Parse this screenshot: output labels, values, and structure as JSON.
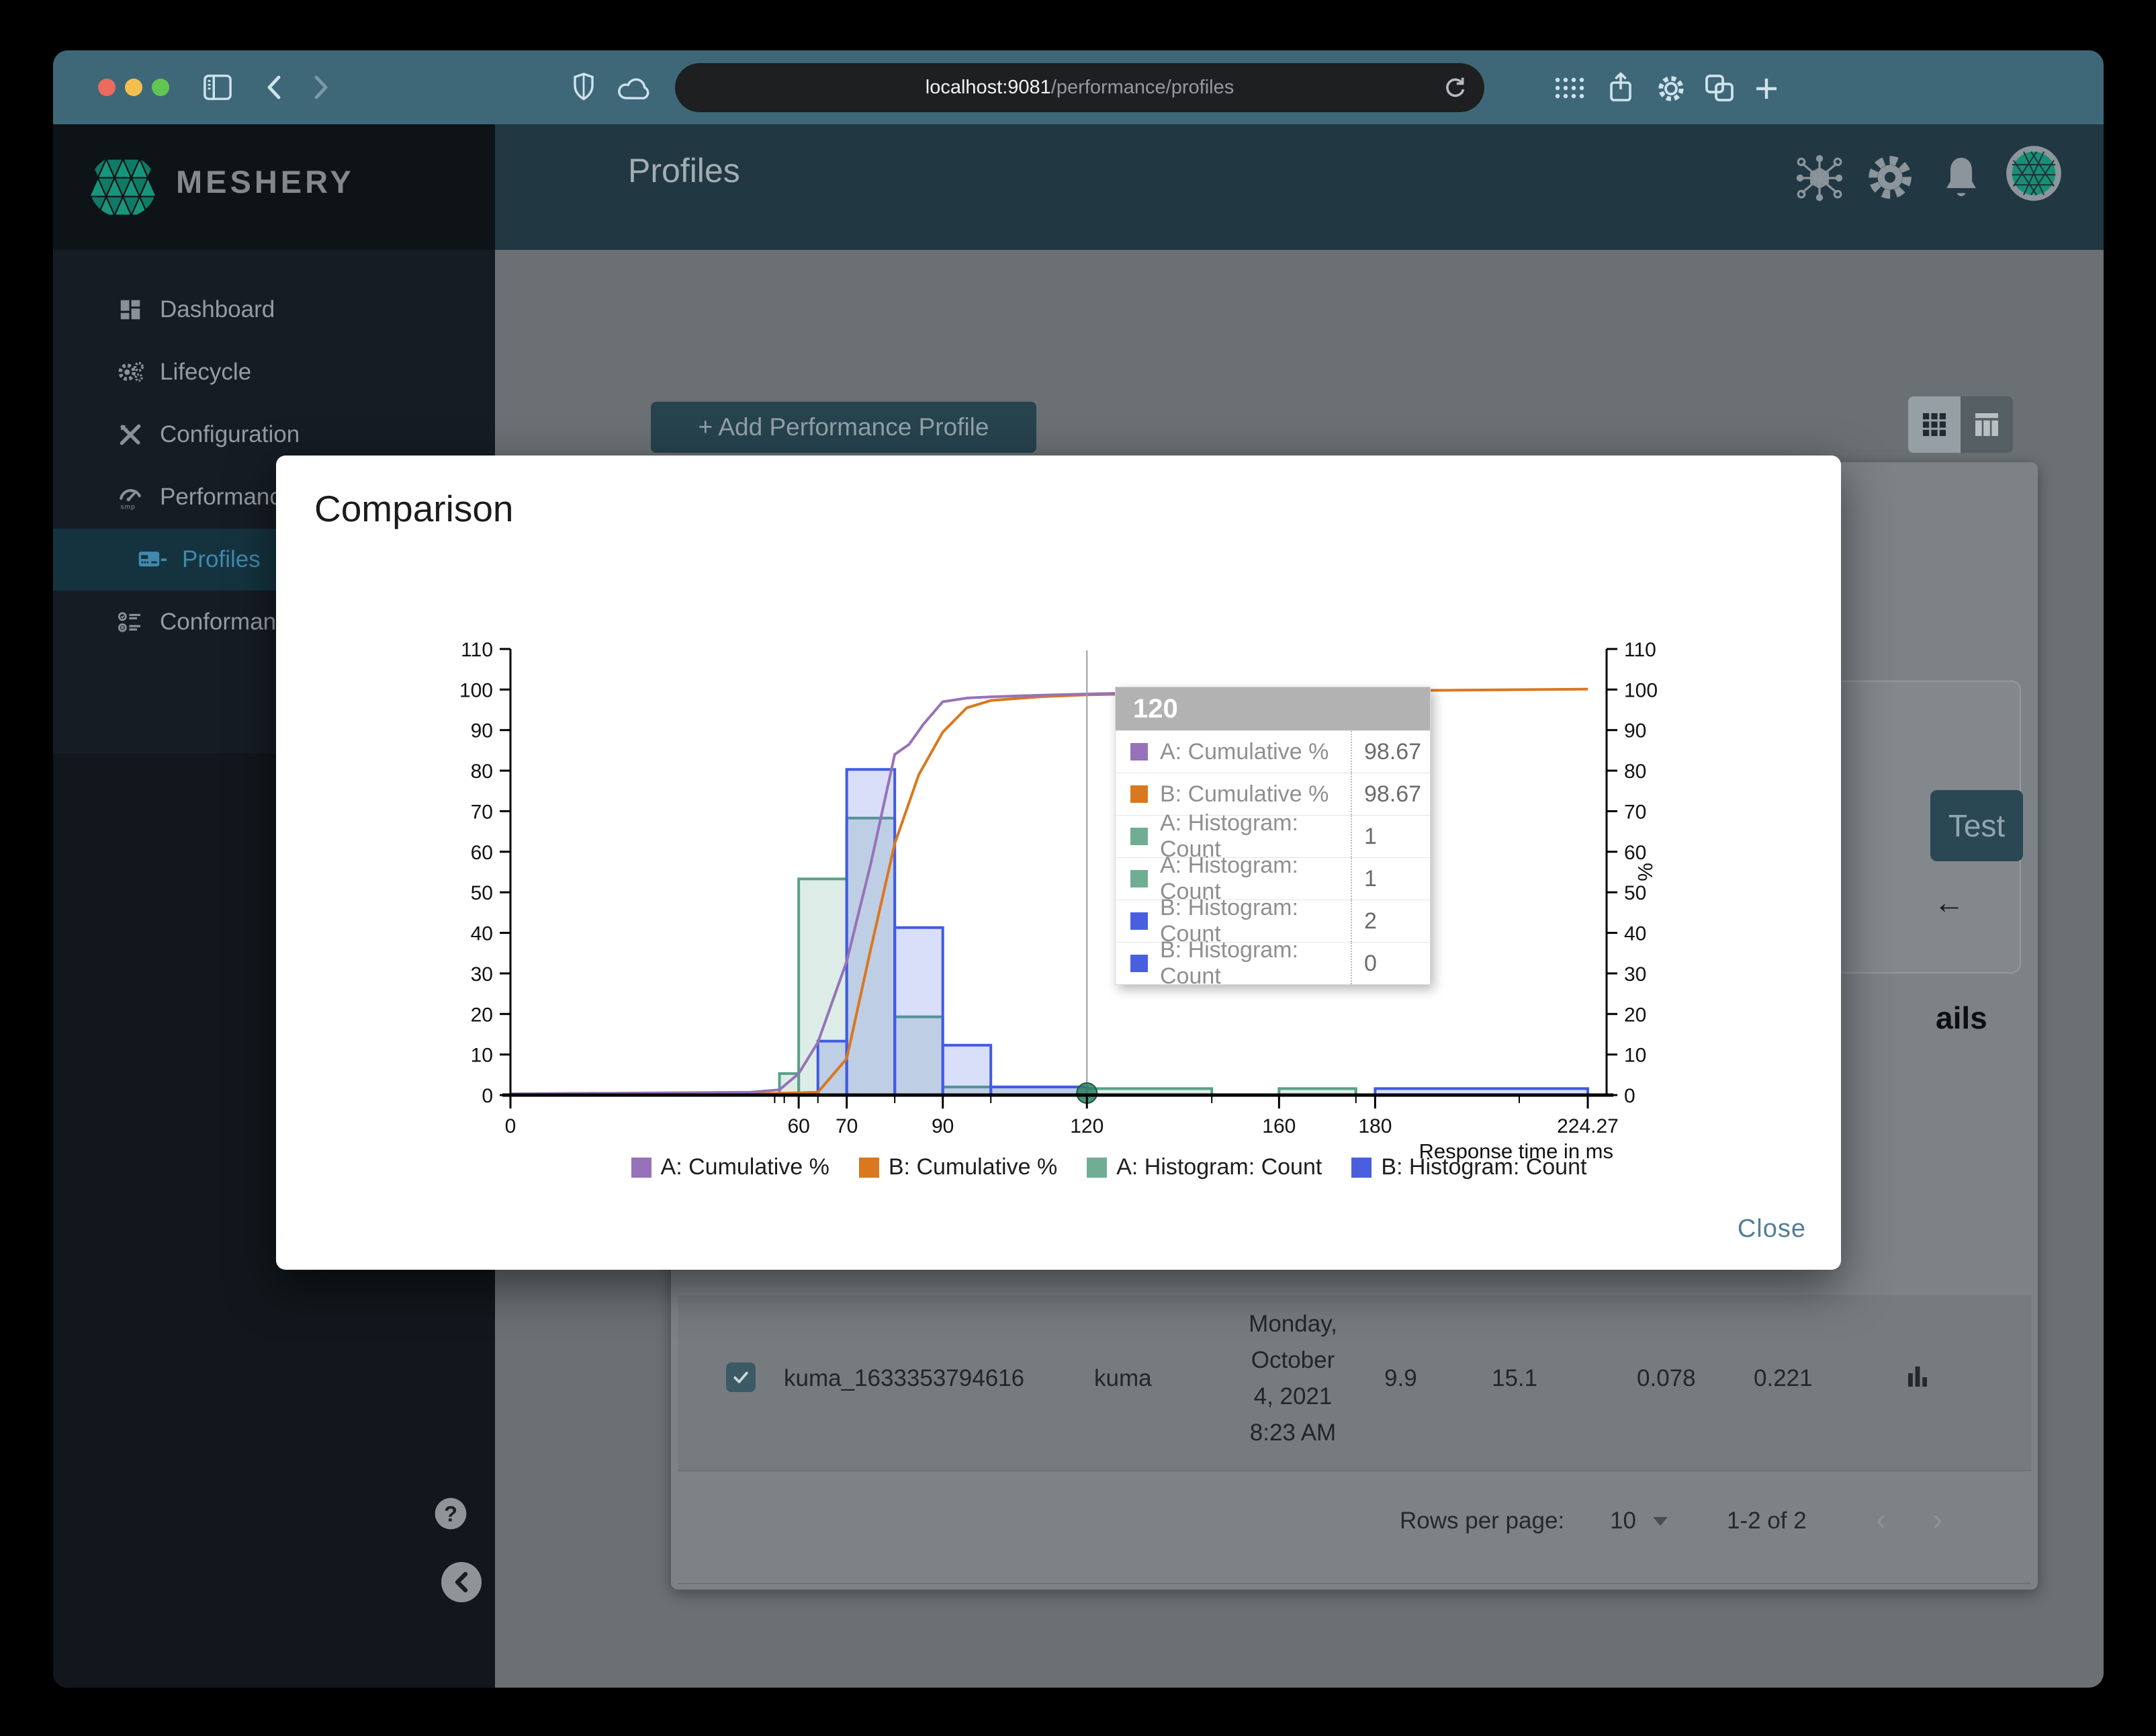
{
  "browser": {
    "url_host": "localhost:9081",
    "url_path": "/performance/profiles",
    "traffic_lights": [
      "#ec6a5e",
      "#f4bf4f",
      "#61c554"
    ]
  },
  "sidebar": {
    "brand": "MESHERY",
    "items": [
      {
        "label": "Dashboard",
        "active": false
      },
      {
        "label": "Lifecycle",
        "active": false
      },
      {
        "label": "Configuration",
        "active": false
      },
      {
        "label": "Performance",
        "active": false
      },
      {
        "label": "Profiles",
        "active": true
      },
      {
        "label": "Conformance",
        "active": false
      }
    ]
  },
  "header": {
    "title": "Profiles"
  },
  "content": {
    "add_profile_button": "+ Add Performance Profile",
    "test_button": "Test",
    "back_arrow": "←",
    "partial_heading": "ails",
    "table_row": {
      "name": "kuma_1633353794616",
      "mesh": "kuma",
      "date_lines": [
        "Monday,",
        "October",
        "4, 2021",
        "8:23 AM"
      ],
      "qps": "9.9",
      "duration": "15.1",
      "p50": "0.078",
      "p99": "0.221"
    },
    "pagination": {
      "rows_per_page_label": "Rows per page:",
      "rows_per_page_value": "10",
      "range": "1-2 of 2",
      "prev_icon": "‹",
      "next_icon": "›"
    }
  },
  "modal": {
    "title": "Comparison",
    "close_label": "Close"
  },
  "ui_colors": {
    "toolbar": "#3e6878",
    "header": "#213842",
    "active_nav": "#4189ad",
    "close_button": "#527e93"
  },
  "chart_data": {
    "type": "histogram+cumulative-line",
    "xlabel": "Response time in ms",
    "right_ylabel": "%",
    "xlim": [
      0,
      224.27
    ],
    "ylim": [
      0,
      110
    ],
    "x_ticks": [
      0,
      60,
      70,
      90,
      120,
      160,
      180,
      224.27
    ],
    "x_minor_ticks": [
      55,
      57,
      64,
      80,
      100,
      146,
      176,
      210
    ],
    "y_ticks": [
      0,
      10,
      20,
      30,
      40,
      50,
      60,
      70,
      80,
      90,
      100,
      110
    ],
    "grid": false,
    "legend_position": "bottom",
    "series": [
      {
        "name": "A: Cumulative %",
        "type": "line",
        "color": "#9673b9",
        "points": [
          [
            0,
            0.3
          ],
          [
            50,
            0.7
          ],
          [
            56,
            1.3
          ],
          [
            60,
            5.3
          ],
          [
            64,
            13
          ],
          [
            70,
            33
          ],
          [
            75,
            57
          ],
          [
            80,
            84
          ],
          [
            83,
            86.5
          ],
          [
            86,
            91.5
          ],
          [
            90,
            97
          ],
          [
            95,
            97.9
          ],
          [
            100,
            98.2
          ],
          [
            110,
            98.6
          ],
          [
            120,
            98.9
          ],
          [
            135,
            99.3
          ],
          [
            150,
            99.8
          ],
          [
            170,
            100.4
          ]
        ]
      },
      {
        "name": "B: Cumulative %",
        "type": "line",
        "color": "#d9781f",
        "points": [
          [
            0,
            0.1
          ],
          [
            55,
            0.4
          ],
          [
            64,
            0.7
          ],
          [
            70,
            9
          ],
          [
            75,
            36
          ],
          [
            80,
            62
          ],
          [
            85,
            79
          ],
          [
            90,
            89.5
          ],
          [
            95,
            95.5
          ],
          [
            100,
            97.3
          ],
          [
            110,
            98.2
          ],
          [
            120,
            98.7
          ],
          [
            140,
            99.1
          ],
          [
            160,
            99.4
          ],
          [
            180,
            99.7
          ],
          [
            224.27,
            100.1
          ]
        ]
      },
      {
        "name": "A: Histogram: Count",
        "type": "histogram",
        "color": "#58a188",
        "bins": [
          [
            56,
            60,
            5.3
          ],
          [
            60,
            70,
            53.3
          ],
          [
            70,
            80,
            68.3
          ],
          [
            80,
            90,
            19.3
          ],
          [
            90,
            120,
            2
          ],
          [
            120,
            146,
            1.6
          ],
          [
            160,
            176,
            1.6
          ]
        ]
      },
      {
        "name": "B: Histogram: Count",
        "type": "histogram",
        "color": "#415be3",
        "bins": [
          [
            64,
            70,
            13.3
          ],
          [
            70,
            80,
            80.3
          ],
          [
            80,
            90,
            41.3
          ],
          [
            90,
            100,
            12.3
          ],
          [
            100,
            120,
            2
          ],
          [
            180,
            224.27,
            1.6
          ]
        ]
      }
    ],
    "guideline": {
      "x": 120,
      "dot_color": "#2e7f63"
    },
    "tooltip": {
      "header": "120",
      "rows": [
        {
          "color": "#9673b9",
          "label": "A: Cumulative %",
          "value": "98.67"
        },
        {
          "color": "#d9781f",
          "label": "B: Cumulative %",
          "value": "98.67"
        },
        {
          "color": "#6fae93",
          "label": "A: Histogram: Count",
          "value": "1"
        },
        {
          "color": "#6fae93",
          "label": "A: Histogram: Count",
          "value": "1"
        },
        {
          "color": "#4a5fe0",
          "label": "B: Histogram: Count",
          "value": "2"
        },
        {
          "color": "#4a5fe0",
          "label": "B: Histogram: Count",
          "value": "0"
        }
      ]
    },
    "legend": [
      {
        "label": "A: Cumulative %",
        "color": "#9673b9"
      },
      {
        "label": "B: Cumulative %",
        "color": "#d9781f"
      },
      {
        "label": "A: Histogram: Count",
        "color": "#6fae93"
      },
      {
        "label": "B: Histogram: Count",
        "color": "#4a5fe0"
      }
    ]
  }
}
